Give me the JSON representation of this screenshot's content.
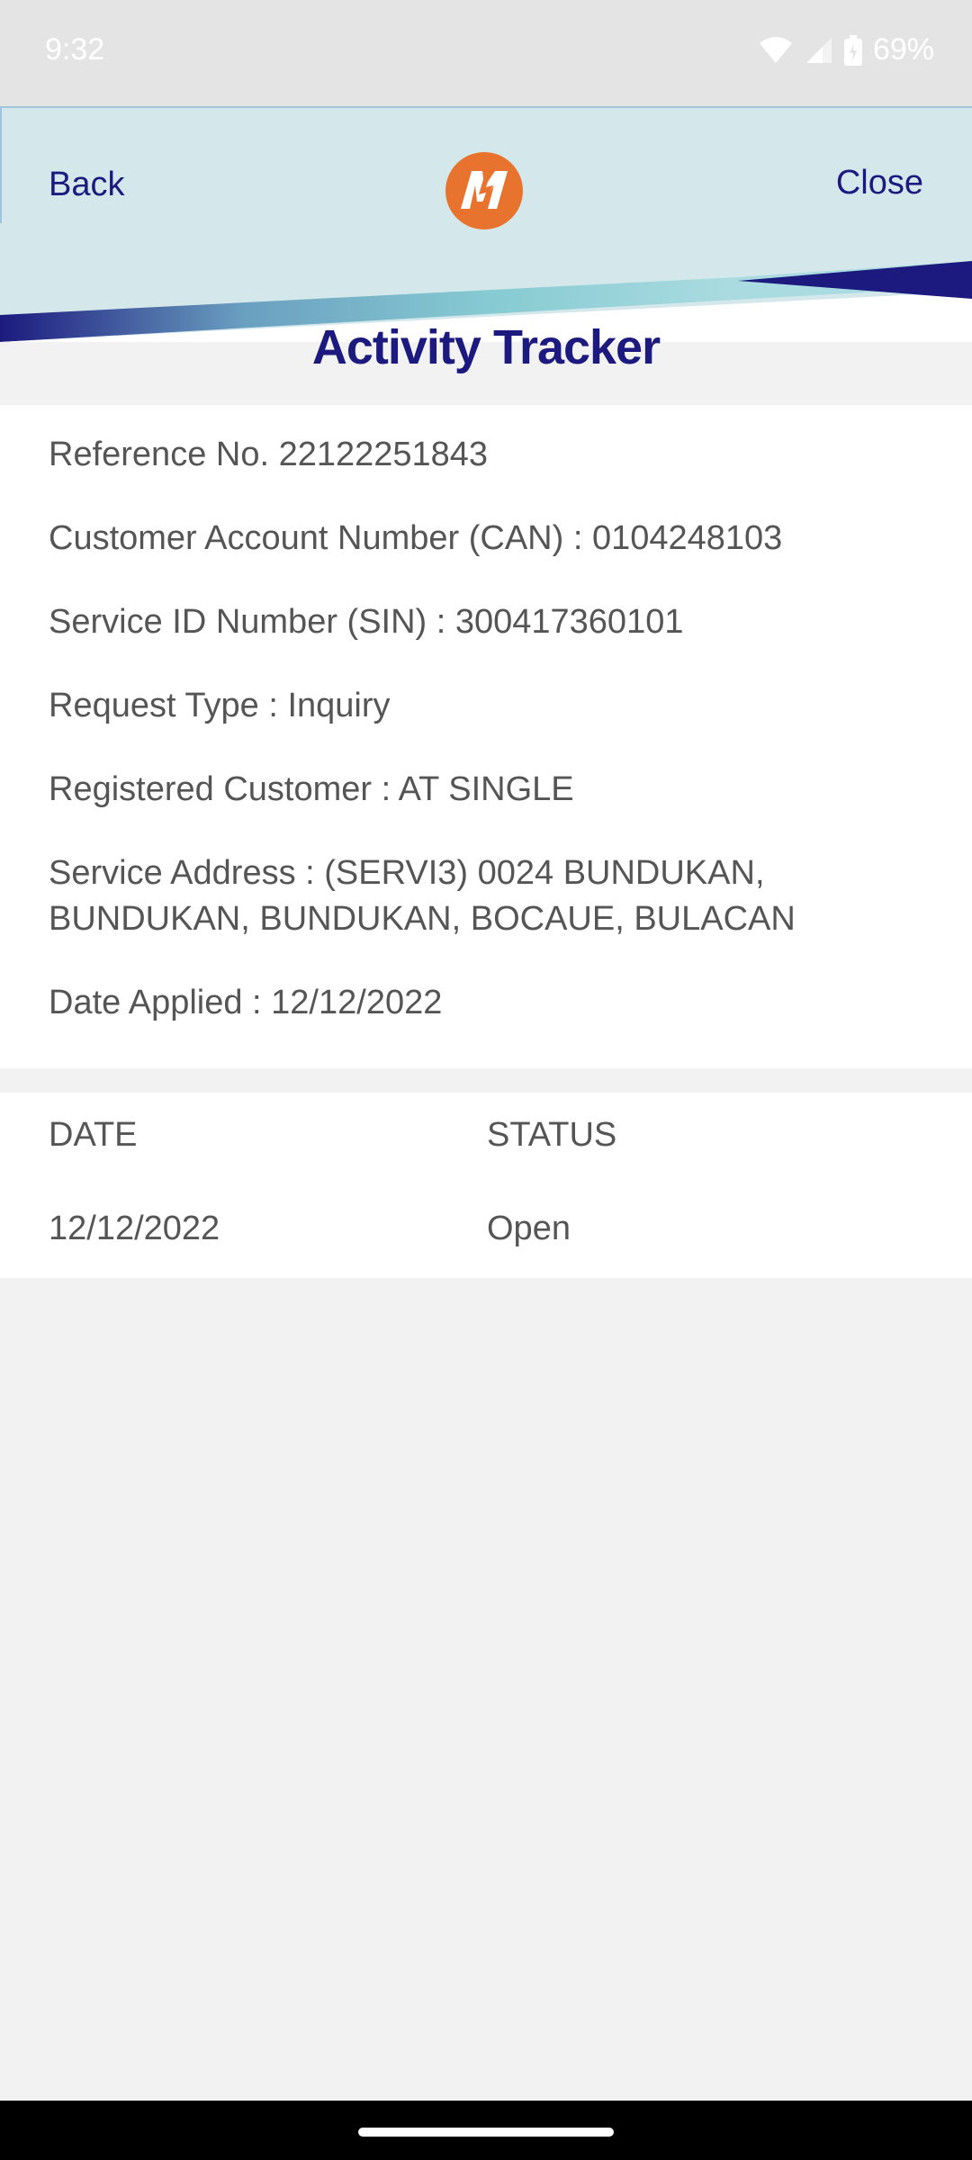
{
  "status_bar": {
    "time": "9:32",
    "battery": "69%",
    "icons": [
      "wifi-icon",
      "cellular-signal-icon",
      "battery-icon"
    ]
  },
  "header": {
    "back_label": "Back",
    "close_label": "Close",
    "logo": "meralco-logo",
    "colors": {
      "light_blue": "#d4e8ec",
      "teal": "#7ec4cc",
      "navy": "#1c1a7e",
      "logo_orange": "#e8732e"
    }
  },
  "page": {
    "title": "Activity Tracker"
  },
  "details": {
    "reference": "Reference No. 22122251843",
    "can": "Customer Account Number (CAN) : 0104248103",
    "sin": "Service ID Number (SIN) : 300417360101",
    "request_type": "Request Type : Inquiry",
    "registered_customer": "Registered Customer : AT SINGLE",
    "service_address_line1": "Service Address : (SERVI3) 0024 BUNDUKAN,",
    "service_address_line2": "BUNDUKAN, BUNDUKAN, BOCAUE, BULACAN",
    "date_applied": "Date Applied : 12/12/2022"
  },
  "status_table": {
    "headers": [
      "DATE",
      "STATUS"
    ],
    "rows": [
      [
        "12/12/2022",
        "Open"
      ]
    ]
  }
}
